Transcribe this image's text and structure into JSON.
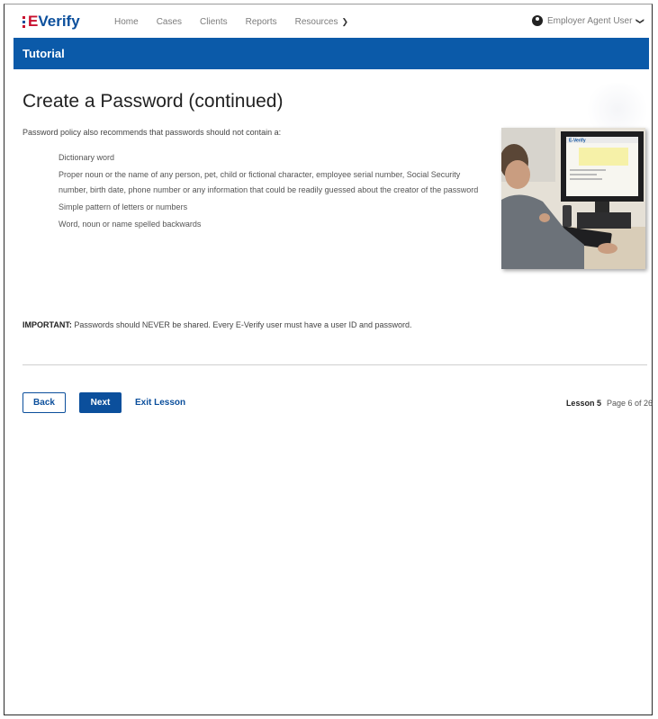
{
  "brand": {
    "logo_e": "E",
    "logo_text": "Verify"
  },
  "nav": {
    "items": [
      "Home",
      "Cases",
      "Clients",
      "Reports"
    ],
    "resources_label": "Resources",
    "user_label": "Employer Agent User"
  },
  "banner": {
    "title": "Tutorial"
  },
  "page": {
    "title": "Create a Password (continued)",
    "intro": "Password policy also recommends that passwords should not contain a:",
    "list": [
      "Dictionary word",
      "Proper noun or the name of any person, pet, child or fictional character, employee serial number, Social Security number, birth date, phone number or any information that could be readily guessed about the creator of the password",
      "Simple pattern of letters or numbers",
      "Word, noun or name spelled backwards"
    ],
    "important_label": "IMPORTANT:",
    "important_text": " Passwords should NEVER be shared. Every E-Verify user must have a user ID and password.",
    "photo_screen_label": "E-Verify"
  },
  "controls": {
    "back": "Back",
    "next": "Next",
    "exit": "Exit Lesson"
  },
  "pager": {
    "lesson": "Lesson 5",
    "page": "Page 6 of 26"
  },
  "colors": {
    "brand_blue": "#0b5aa9",
    "link_blue": "#0b4f9c",
    "logo_red": "#c8102e"
  }
}
